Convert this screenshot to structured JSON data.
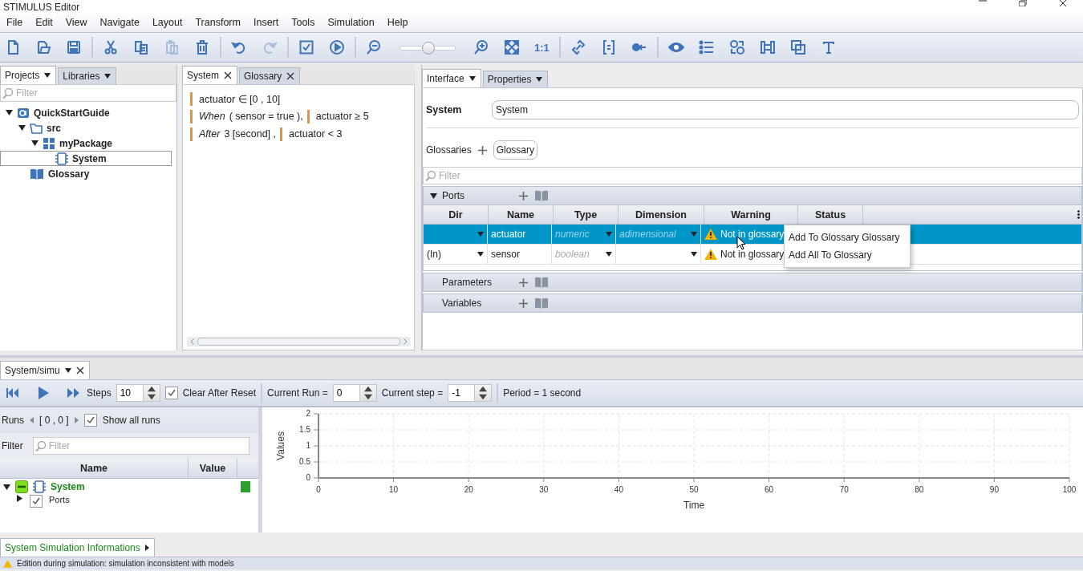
{
  "window": {
    "title": "STIMULUS Editor"
  },
  "menu": [
    "File",
    "Edit",
    "View",
    "Navigate",
    "Layout",
    "Transform",
    "Insert",
    "Tools",
    "Simulation",
    "Help"
  ],
  "toolbar": [
    [
      {
        "kind": "button",
        "disabled": false
      },
      {
        "kind": "button",
        "disabled": false
      },
      {
        "kind": "button",
        "disabled": false
      }
    ],
    [
      {
        "kind": "button",
        "disabled": false
      },
      {
        "kind": "button",
        "disabled": false
      },
      {
        "kind": "button",
        "disabled": true
      },
      {
        "kind": "button",
        "disabled": false
      }
    ],
    [
      {
        "kind": "button",
        "disabled": false
      },
      {
        "kind": "button",
        "disabled": true
      }
    ],
    [
      {
        "kind": "button",
        "disabled": false
      },
      {
        "kind": "button",
        "disabled": false
      }
    ],
    [
      {
        "kind": "button",
        "disabled": false
      },
      {
        "kind": "slider",
        "level": 0.52
      },
      {
        "kind": "button",
        "disabled": false
      },
      {
        "kind": "button",
        "disabled": false
      },
      {
        "kind": "label",
        "label": "1:1"
      }
    ],
    [
      {
        "kind": "button",
        "disabled": false
      },
      {
        "kind": "button",
        "disabled": false
      },
      {
        "kind": "button",
        "disabled": false
      }
    ],
    [
      {
        "kind": "button",
        "disabled": false
      },
      {
        "kind": "button",
        "disabled": false
      },
      {
        "kind": "button",
        "disabled": false
      },
      {
        "kind": "button",
        "disabled": false
      },
      {
        "kind": "button",
        "disabled": false
      },
      {
        "kind": "button",
        "disabled": false
      }
    ]
  ],
  "projects": {
    "tabs": [
      {
        "label": "Projects",
        "selected": true
      },
      {
        "label": "Libraries",
        "selected": false
      }
    ],
    "filter": {
      "placeholder": "Filter"
    },
    "tree": [
      {
        "label": "QuickStartGuide",
        "kind": "project",
        "expanded": true,
        "selected": false,
        "children": [
          {
            "label": "src",
            "kind": "folder",
            "expanded": true,
            "selected": false,
            "children": [
              {
                "label": "myPackage",
                "kind": "package",
                "expanded": true,
                "selected": false,
                "children": [
                  {
                    "label": "System",
                    "kind": "system",
                    "selected": true
                  }
                ]
              }
            ]
          },
          {
            "label": "Glossary",
            "kind": "glossary",
            "selected": false
          }
        ]
      }
    ]
  },
  "editor": {
    "tabs": [
      {
        "label": "System",
        "selected": true
      },
      {
        "label": "Glossary",
        "selected": false
      }
    ],
    "lines": [
      [
        {
          "kind": "bar"
        },
        {
          "kind": "text",
          "text": "actuator ∈ [0 ,  10]"
        }
      ],
      [
        {
          "kind": "bar"
        },
        {
          "kind": "keyword",
          "text": "When"
        },
        {
          "kind": "text",
          "text": "( sensor  =  true ),"
        },
        {
          "kind": "bar"
        },
        {
          "kind": "text",
          "text": "actuator  ≥  5"
        }
      ],
      [
        {
          "kind": "bar"
        },
        {
          "kind": "keyword",
          "text": "After"
        },
        {
          "kind": "text",
          "text": "3 [second] ,"
        },
        {
          "kind": "bar"
        },
        {
          "kind": "text",
          "text": "actuator  <  3"
        }
      ]
    ]
  },
  "inspector": {
    "tabs": [
      {
        "label": "Interface",
        "selected": true
      },
      {
        "label": "Properties",
        "selected": false
      }
    ],
    "name_label": "System",
    "name_value": "System",
    "glossaries_label": "Glossaries",
    "glossary_chips": [
      "Glossary"
    ],
    "filter": {
      "placeholder": "Filter"
    },
    "sections": [
      {
        "title": "Ports",
        "expanded": true,
        "columns": [
          "Dir",
          "Name",
          "Type",
          "Dimension",
          "Warning",
          "Status"
        ],
        "rows": [
          {
            "name": "actuator",
            "type": "numeric",
            "dimension": "adimensional",
            "warning": "Not in glossary",
            "selected": true
          },
          {
            "dir": "(In)",
            "name": "sensor",
            "type": "boolean",
            "warning": "Not in glossary",
            "selected": false
          }
        ]
      },
      {
        "title": "Parameters",
        "expanded": false
      },
      {
        "title": "Variables",
        "expanded": false
      }
    ],
    "context_menu": [
      "Add To Glossary Glossary",
      "Add All To Glossary"
    ]
  },
  "simulation": {
    "tab": {
      "label": "System/simu",
      "selected": true
    },
    "toolbar": {
      "steps_label": "Steps",
      "steps": "10",
      "clear_label": "Clear After Reset",
      "clear_checked": true,
      "run_label": "Current Run =",
      "run": "0",
      "step_label": "Current step =",
      "step": "-1",
      "period": "Period = 1 second"
    },
    "runs": {
      "label": "Runs",
      "range": "[ 0 , 0 ]",
      "show_all_label": "Show all runs",
      "show_all_checked": true
    },
    "filter_label": "Filter",
    "filter": {
      "placeholder": "Filter"
    },
    "table": {
      "columns": [
        "Name",
        "Value"
      ],
      "rows": [
        {
          "name": "System",
          "indeterminate": true,
          "expanded": true,
          "color": "#2e9e2e",
          "children": [
            {
              "name": "Ports",
              "checked": true,
              "indeterminate": false,
              "expanded": false
            }
          ]
        }
      ]
    },
    "chart_data": {
      "type": "line",
      "grid": true,
      "xlabel": "Time",
      "ylabel": "Values",
      "xlim": [
        0,
        100
      ],
      "ylim": [
        0,
        2
      ],
      "xticks": [
        0,
        10,
        20,
        30,
        40,
        50,
        60,
        70,
        80,
        90,
        100
      ],
      "yticks": [
        0,
        0.5,
        1,
        1.5,
        2
      ]
    }
  },
  "bottom": {
    "tab": "System Simulation Informations",
    "status": "Edition during simulation: simulation inconsistent with models"
  }
}
